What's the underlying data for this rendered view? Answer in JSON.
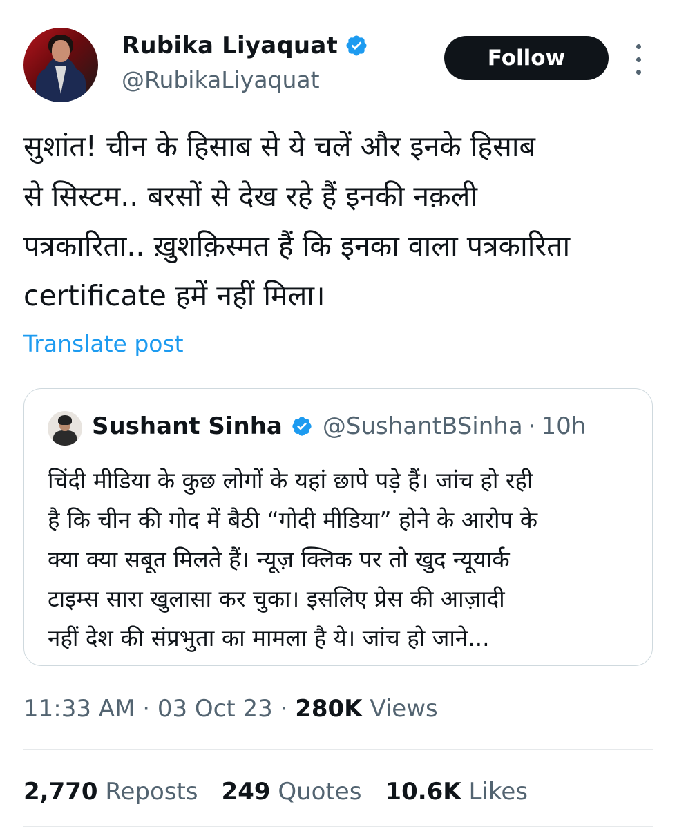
{
  "author": {
    "name": "Rubika Liyaquat",
    "handle": "@RubikaLiyaquat",
    "verified_color": "#1d9bf0"
  },
  "actions": {
    "follow_label": "Follow"
  },
  "tweet": {
    "lines": [
      "सुशांत! चीन के हिसाब से ये चलें और इनके हिसाब",
      "से सिस्टम.. बरसों से देख रहे हैं इनकी नक़ली",
      "पत्रकारिता.. ख़ुशक़िस्मत हैं कि इनका वाला पत्रकारिता",
      "certificate हमें नहीं मिला।"
    ],
    "translate_label": "Translate post"
  },
  "quote": {
    "name": "Sushant Sinha",
    "handle": "@SushantBSinha",
    "separator": "·",
    "time": "10h",
    "lines": [
      "चिंदी मीडिया के कुछ लोगों के यहां छापे पड़े हैं। जांच हो रही",
      "है कि चीन की गोद में बैठी “गोदी मीडिया” होने के आरोप के",
      "क्या क्या सबूत मिलते हैं। न्यूज़ क्लिक पर तो खुद न्यूयार्क",
      "टाइम्स सारा खुलासा कर चुका। इसलिए प्रेस की आज़ादी",
      "नहीं देश की संप्रभुता का मामला है ये। जांच हो जाने..."
    ]
  },
  "meta": {
    "time": "11:33 AM",
    "date": "03 Oct 23",
    "sep": "·",
    "views_count": "280K",
    "views_label": "Views"
  },
  "stats": {
    "reposts_count": "2,770",
    "reposts_label": "Reposts",
    "quotes_count": "249",
    "quotes_label": "Quotes",
    "likes_count": "10.6K",
    "likes_label": "Likes"
  },
  "icons": {
    "verified": "verified-badge-icon",
    "more": "more-vertical-icon"
  }
}
